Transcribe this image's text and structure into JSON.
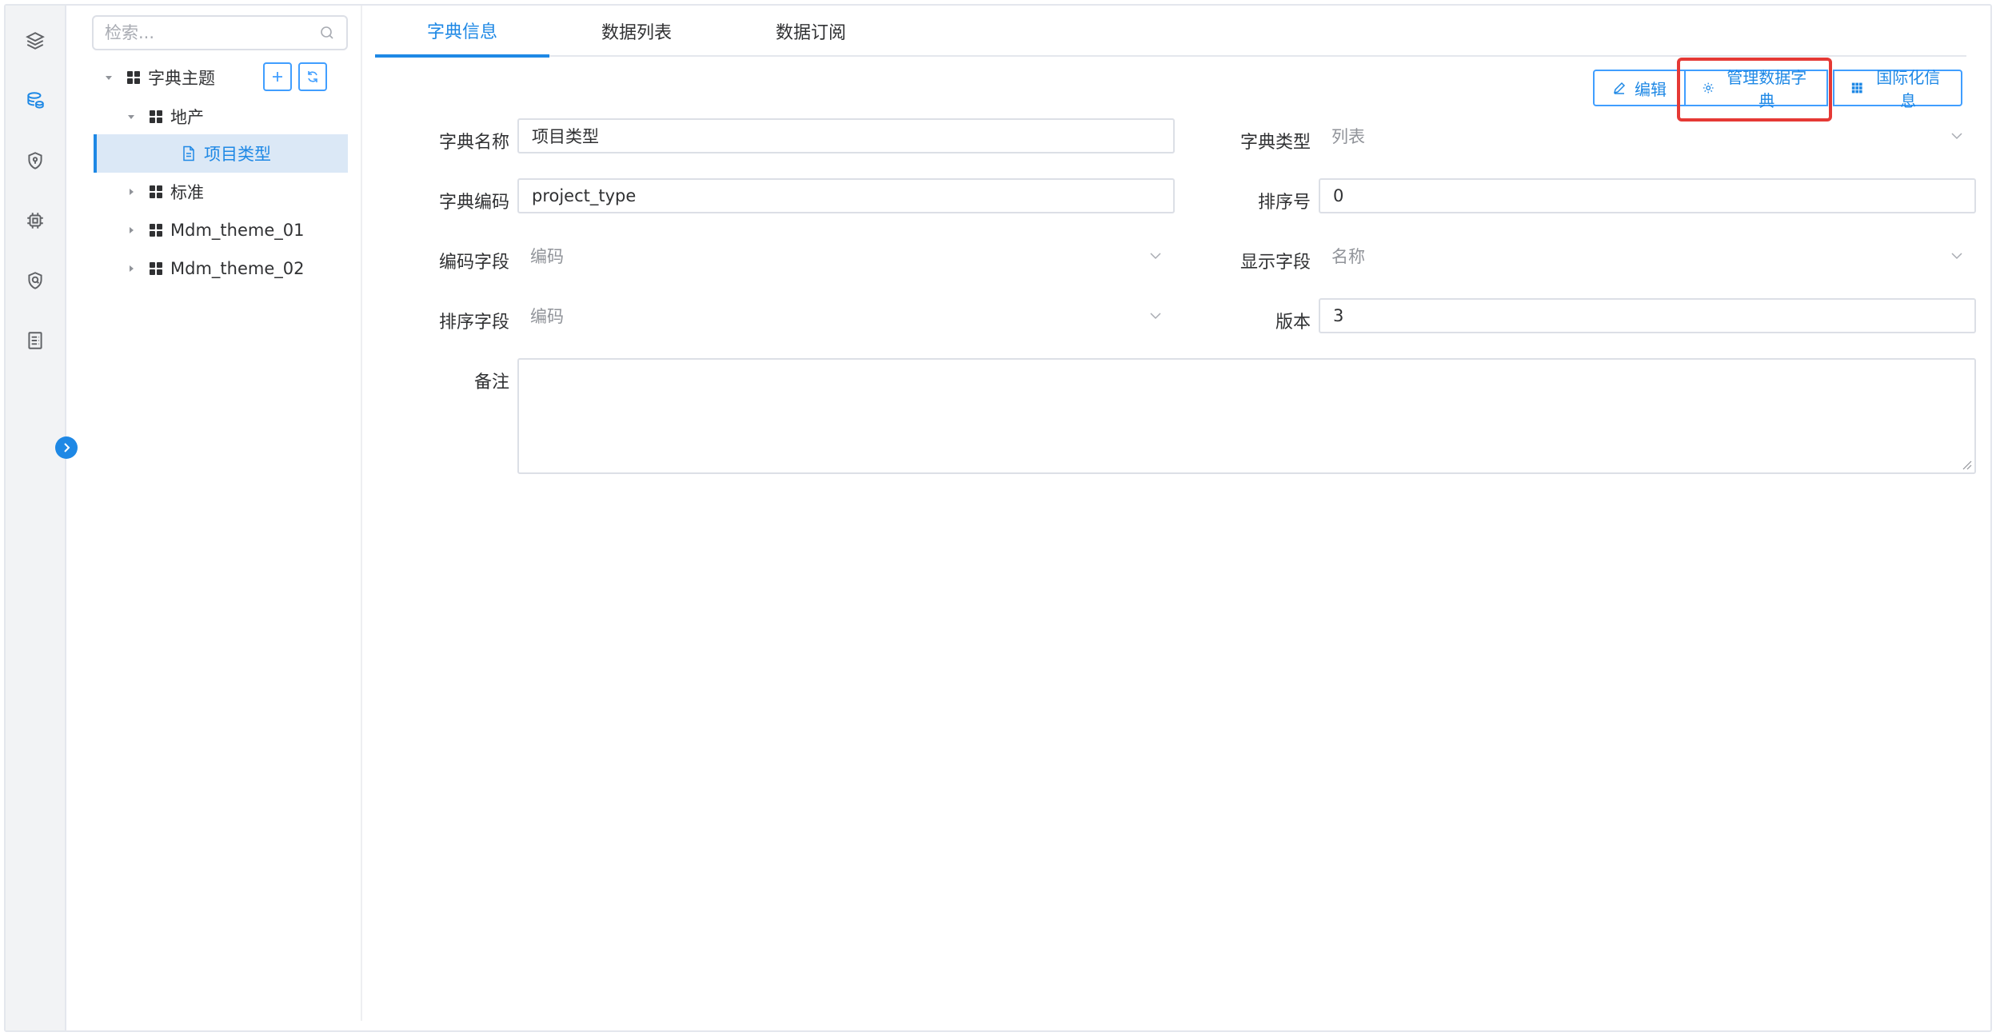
{
  "rail": {
    "icons": [
      "layers-icon",
      "database-icon",
      "shield-location-icon",
      "chip-icon",
      "shield-check-icon",
      "document-list-icon"
    ],
    "accent": "#1e88e5"
  },
  "tree": {
    "search_placeholder": "检索...",
    "nodes": [
      {
        "label": "字典主题"
      },
      {
        "label": "地产"
      },
      {
        "label": "项目类型"
      },
      {
        "label": "标准"
      },
      {
        "label": "Mdm_theme_01"
      },
      {
        "label": "Mdm_theme_02"
      }
    ]
  },
  "tabs": [
    {
      "label": "字典信息"
    },
    {
      "label": "数据列表"
    },
    {
      "label": "数据订阅"
    }
  ],
  "actions": {
    "edit": "编辑",
    "manage": "管理数据字典",
    "i18n": "国际化信息"
  },
  "form": {
    "dict_name": {
      "label": "字典名称",
      "value": "项目类型"
    },
    "dict_type": {
      "label": "字典类型",
      "value": "列表"
    },
    "dict_code": {
      "label": "字典编码",
      "value": "project_type"
    },
    "sort_no": {
      "label": "排序号",
      "value": "0"
    },
    "code_field": {
      "label": "编码字段",
      "value": "编码"
    },
    "display_field": {
      "label": "显示字段",
      "value": "名称"
    },
    "sort_field": {
      "label": "排序字段",
      "value": "编码"
    },
    "version": {
      "label": "版本",
      "value": "3"
    },
    "remark": {
      "label": "备注",
      "value": ""
    }
  }
}
